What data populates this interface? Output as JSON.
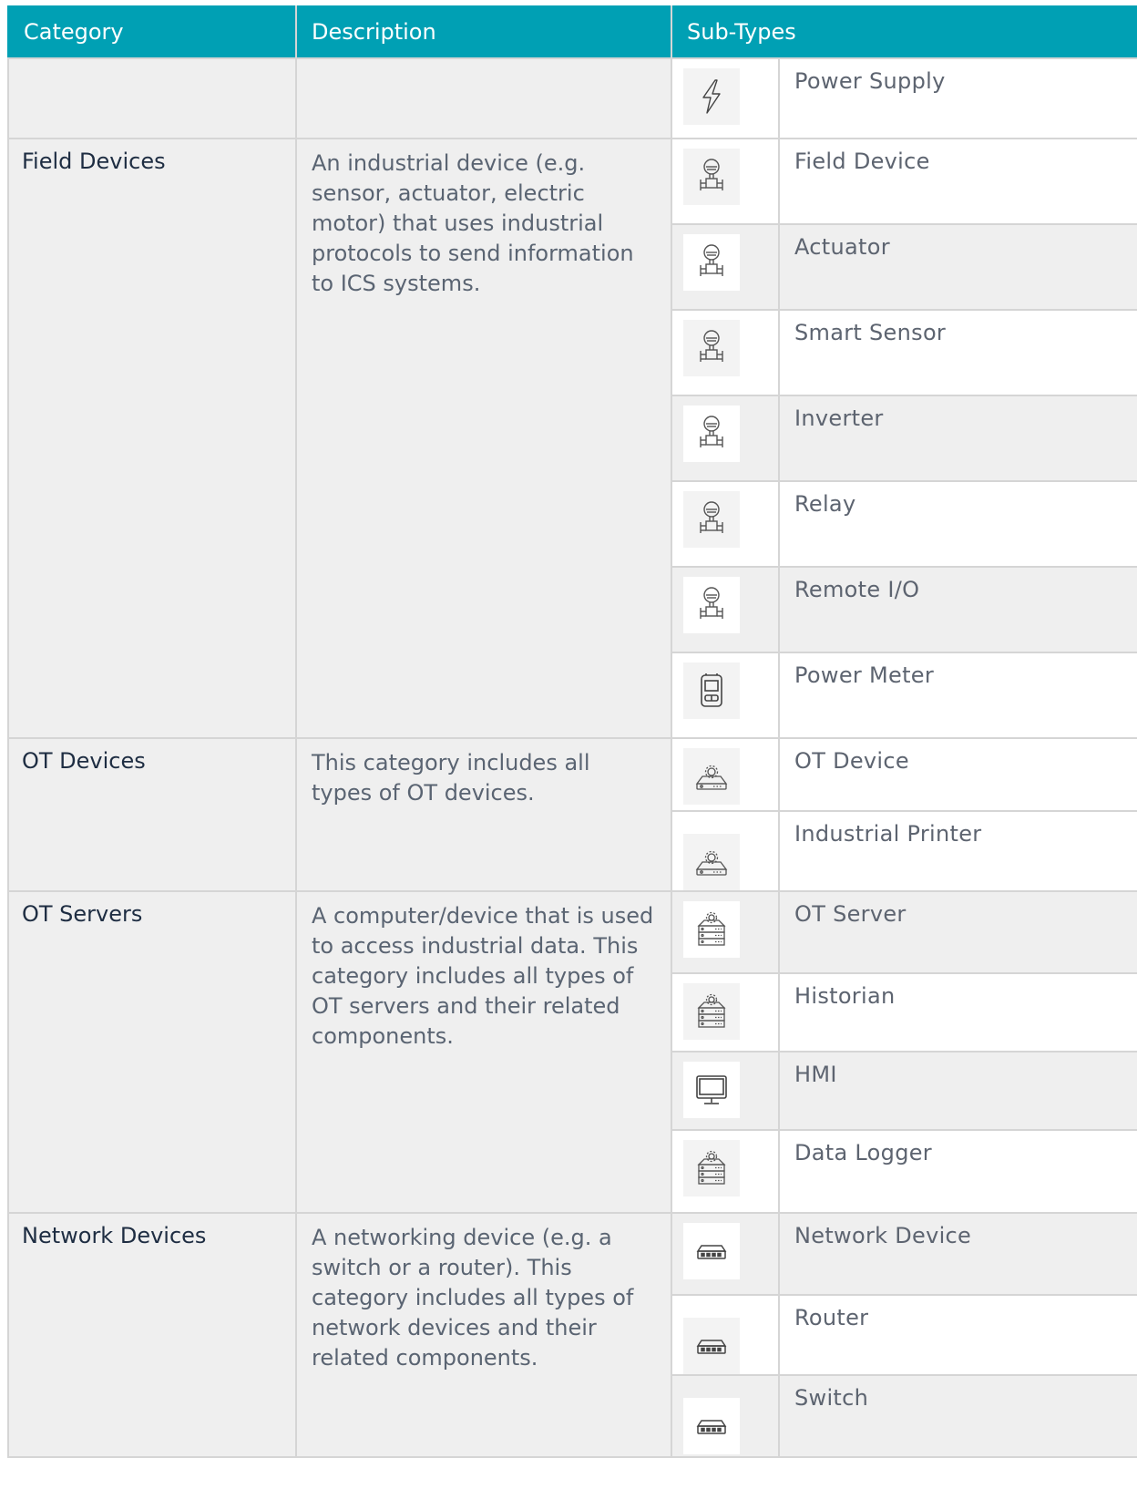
{
  "headers": {
    "category": "Category",
    "description": "Description",
    "subtypes": "Sub-Types"
  },
  "rows": {
    "r0": {
      "name": "Power Supply",
      "icon": "power-supply-icon"
    },
    "field_devices": {
      "category": "Field Devices",
      "description": "An industrial device (e.g. sensor, actuator, electric motor) that uses industrial protocols to send information to ICS systems.",
      "subtypes": [
        {
          "name": "Field Device",
          "icon": "field-device-icon"
        },
        {
          "name": "Actuator",
          "icon": "field-device-icon"
        },
        {
          "name": "Smart Sensor",
          "icon": "field-device-icon"
        },
        {
          "name": "Inverter",
          "icon": "field-device-icon"
        },
        {
          "name": "Relay",
          "icon": "field-device-icon"
        },
        {
          "name": "Remote I/O",
          "icon": "field-device-icon"
        },
        {
          "name": "Power Meter",
          "icon": "power-meter-icon"
        }
      ]
    },
    "ot_devices": {
      "category": "OT Devices",
      "description": "This category includes all types of OT devices.",
      "subtypes": [
        {
          "name": "OT Device",
          "icon": "ot-device-icon"
        },
        {
          "name": "Industrial Printer",
          "icon": "ot-device-icon"
        }
      ]
    },
    "ot_servers": {
      "category": "OT Servers",
      "description": "A computer/device that is used to access industrial data. This category includes all types of OT servers and their related components.",
      "subtypes": [
        {
          "name": "OT Server",
          "icon": "ot-server-icon"
        },
        {
          "name": "Historian",
          "icon": "ot-server-icon"
        },
        {
          "name": "HMI",
          "icon": "monitor-icon"
        },
        {
          "name": "Data Logger",
          "icon": "ot-server-icon"
        }
      ]
    },
    "network_devices": {
      "category": "Network Devices",
      "description": "A networking device (e.g. a switch or a router). This category includes all types of network devices and their related components.",
      "subtypes": [
        {
          "name": "Network Device",
          "icon": "network-switch-icon"
        },
        {
          "name": "Router",
          "icon": "network-switch-icon"
        },
        {
          "name": "Switch",
          "icon": "network-switch-icon"
        }
      ]
    }
  }
}
